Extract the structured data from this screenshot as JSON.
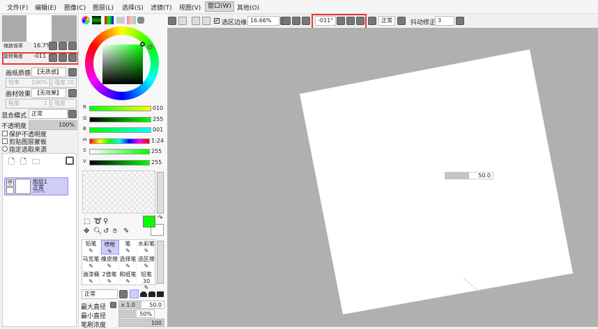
{
  "menu": [
    "文件(F)",
    "编辑(E)",
    "图像(C)",
    "图层(L)",
    "选择(S)",
    "滤镜(T)",
    "视图(V)",
    "窗口(W)",
    "其他(O)"
  ],
  "navigator": {
    "zoom_label": "缩放倍率",
    "zoom_value": "16.7%",
    "rotate_label": "旋转角度",
    "rotate_value": "-011"
  },
  "paper": {
    "texture_label": "画纸质感",
    "texture_value": "【无质感】",
    "scale_label": "倍率",
    "scale_value": "100%",
    "strength_label": "强度",
    "strength_value": "20",
    "effect_label": "画材效果",
    "effect_value": "【无效果】",
    "degree_label": "程度",
    "degree_value": "1",
    "strength2_value": "100"
  },
  "layer": {
    "blend_label": "混合模式",
    "blend_value": "正常",
    "opacity_label": "不透明度",
    "opacity_value": "100%",
    "protect": "保护不透明度",
    "clip": "剪贴图层蒙板",
    "source": "指定选取来源",
    "items": [
      {
        "name": "图层1",
        "mode": "正常",
        "opacity": "100%"
      }
    ]
  },
  "color": {
    "primary": "#0aff01",
    "secondary": "#ffffff",
    "sliders": [
      {
        "label": "R",
        "value": "010"
      },
      {
        "label": "G",
        "value": "255"
      },
      {
        "label": "B",
        "value": "001"
      },
      {
        "label": "H",
        "value": "1:24"
      },
      {
        "label": "S",
        "value": "255"
      },
      {
        "label": "V",
        "value": "255"
      }
    ]
  },
  "tools": [
    "铅笔",
    "喷枪",
    "笔",
    "水彩笔",
    "马克笔",
    "橡皮擦",
    "选择笔",
    "选区擦",
    "油漆桶",
    "2值笔",
    "和纸笔",
    "铅笔30"
  ],
  "brush": {
    "mode": "正常",
    "max_label": "最大直径",
    "max_mult": "x 1.0",
    "max_value": "50.0",
    "min_label": "最小直径",
    "min_value": "50%",
    "density_label": "笔刷浓度",
    "density_value": "100"
  },
  "toolbar": {
    "selection_edge": "选区边缘",
    "zoom": "16.66%",
    "angle": "-011°",
    "blend": "正常",
    "stabilizer_label": "抖动修正",
    "stabilizer": "3"
  },
  "canvas_hud": {
    "value": "50.0",
    "fill": 0.5
  }
}
